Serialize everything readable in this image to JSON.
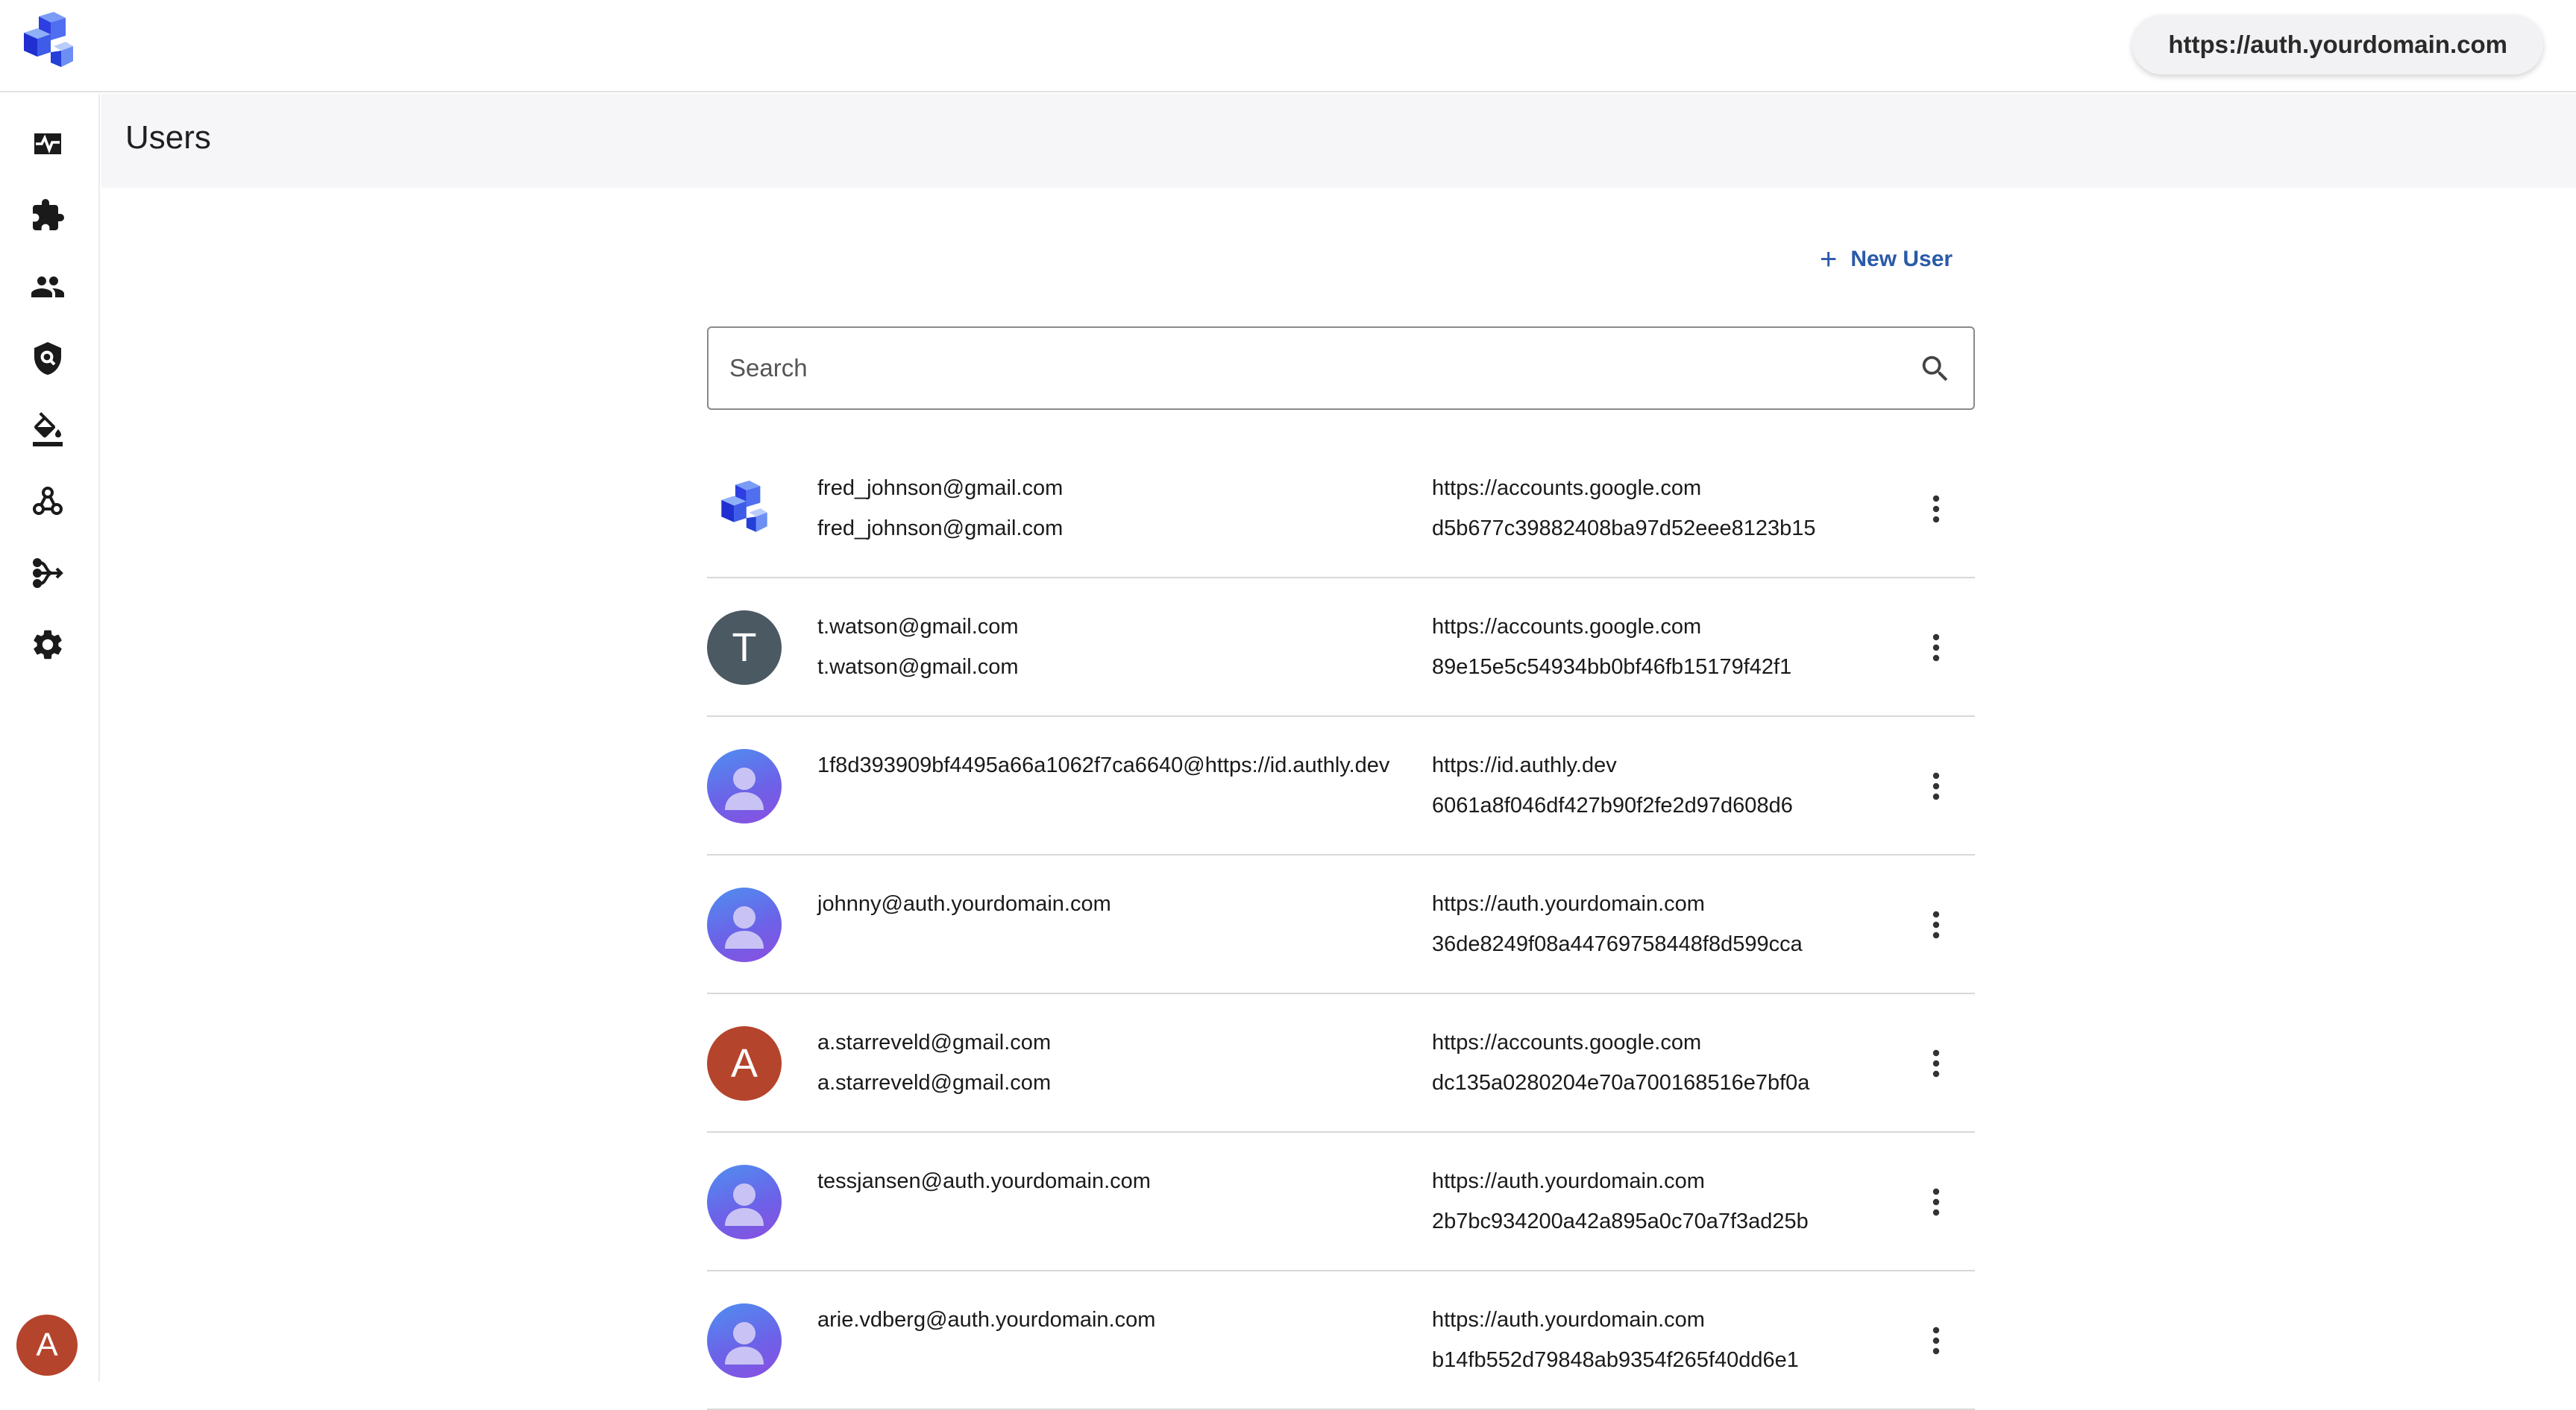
{
  "app": {
    "domain": "https://auth.yourdomain.com"
  },
  "sidebar": {
    "items": [
      {
        "name": "activity-icon"
      },
      {
        "name": "extensions-icon"
      },
      {
        "name": "users-icon"
      },
      {
        "name": "security-icon"
      },
      {
        "name": "branding-icon"
      },
      {
        "name": "webhooks-icon"
      },
      {
        "name": "flows-icon"
      },
      {
        "name": "settings-icon"
      }
    ],
    "current_user_initial": "A"
  },
  "page": {
    "title": "Users"
  },
  "actions": {
    "new_user_label": "New User"
  },
  "search": {
    "placeholder": "Search"
  },
  "users": [
    {
      "avatar_type": "logo",
      "initial": "",
      "avatar_color": "",
      "line1": "fred_johnson@gmail.com",
      "line2": "fred_johnson@gmail.com",
      "issuer": "https://accounts.google.com",
      "subject": "d5b677c39882408ba97d52eee8123b15"
    },
    {
      "avatar_type": "initial",
      "initial": "T",
      "avatar_color": "#4b5962",
      "line1": "t.watson@gmail.com",
      "line2": "t.watson@gmail.com",
      "issuer": "https://accounts.google.com",
      "subject": "89e15e5c54934bb0bf46fb15179f42f1"
    },
    {
      "avatar_type": "generic",
      "initial": "",
      "avatar_color": "",
      "line1": "1f8d393909bf4495a66a1062f7ca6640@https://id.authly.dev",
      "line2": "",
      "issuer": "https://id.authly.dev",
      "subject": "6061a8f046df427b90f2fe2d97d608d6"
    },
    {
      "avatar_type": "generic",
      "initial": "",
      "avatar_color": "",
      "line1": "johnny@auth.yourdomain.com",
      "line2": "",
      "issuer": "https://auth.yourdomain.com",
      "subject": "36de8249f08a44769758448f8d599cca"
    },
    {
      "avatar_type": "initial",
      "initial": "A",
      "avatar_color": "#b5442c",
      "line1": "a.starreveld@gmail.com",
      "line2": "a.starreveld@gmail.com",
      "issuer": "https://accounts.google.com",
      "subject": "dc135a0280204e70a700168516e7bf0a"
    },
    {
      "avatar_type": "generic",
      "initial": "",
      "avatar_color": "",
      "line1": "tessjansen@auth.yourdomain.com",
      "line2": "",
      "issuer": "https://auth.yourdomain.com",
      "subject": "2b7bc934200a42a895a0c70a7f3ad25b"
    },
    {
      "avatar_type": "generic",
      "initial": "",
      "avatar_color": "",
      "line1": "arie.vdberg@auth.yourdomain.com",
      "line2": "",
      "issuer": "https://auth.yourdomain.com",
      "subject": "b14fb552d79848ab9354f265f40dd6e1"
    }
  ]
}
